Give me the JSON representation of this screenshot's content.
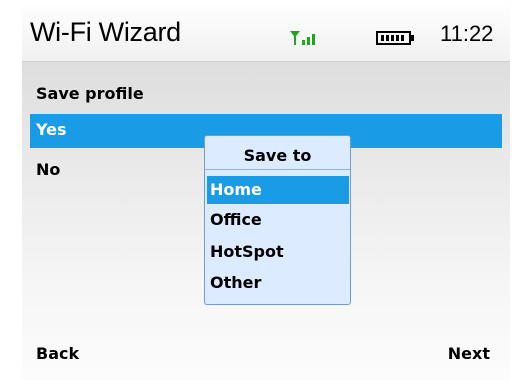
{
  "status_bar": {
    "app_title": "Wi-Fi Wizard",
    "time": "11:22",
    "signal_icon": "signal-strength-icon",
    "battery_icon": "battery-full-icon",
    "signal_color": "#1aa81a"
  },
  "screen": {
    "header": "Save profile",
    "options": [
      {
        "label": "Yes",
        "selected": true
      },
      {
        "label": "No",
        "selected": false
      }
    ]
  },
  "popup": {
    "title": "Save to",
    "items": [
      {
        "label": "Home",
        "selected": true
      },
      {
        "label": "Office",
        "selected": false
      },
      {
        "label": "HotSpot",
        "selected": false
      },
      {
        "label": "Other",
        "selected": false
      }
    ]
  },
  "softkeys": {
    "left": "Back",
    "right": "Next"
  },
  "colors": {
    "highlight": "#1a9be6",
    "popup_background": "#dcebff",
    "popup_border": "#6f9cd4"
  }
}
